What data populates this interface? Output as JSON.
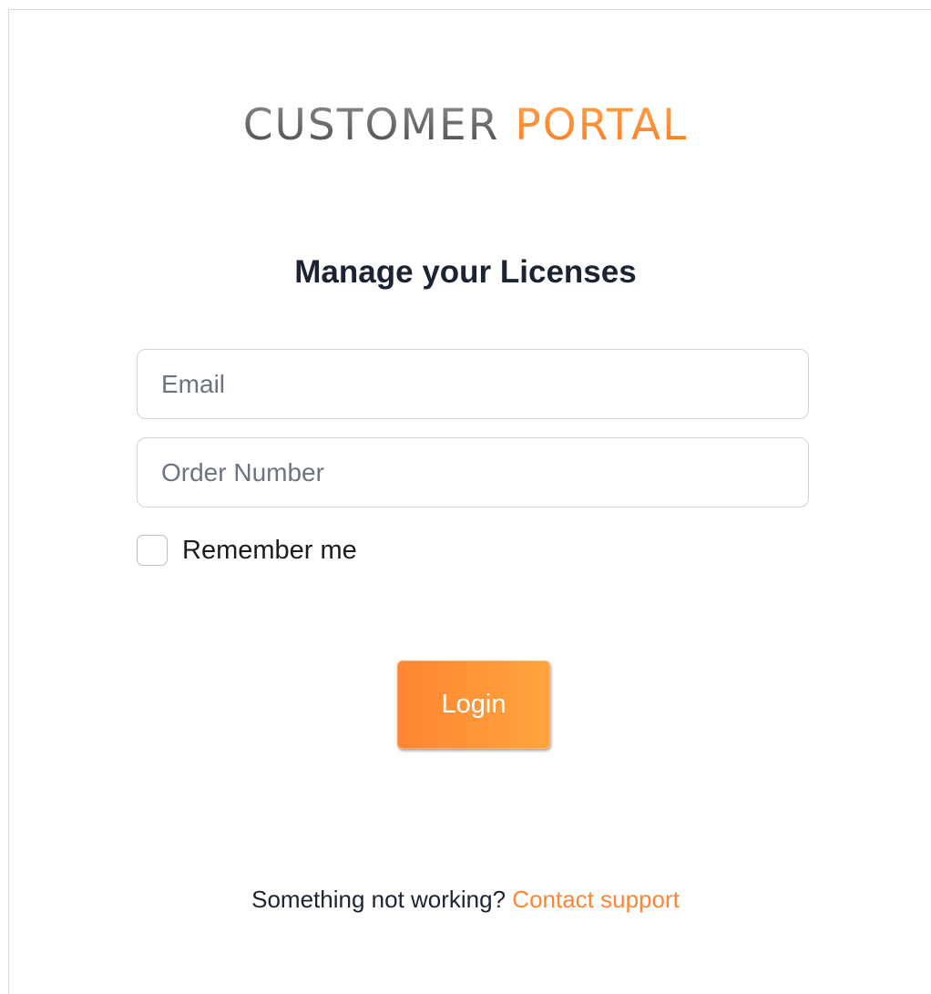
{
  "logo": {
    "word1": "CUSTOMER",
    "word2": "PORTAL",
    "word1_color": "#5a5a5a",
    "word2_color": "#ff8a2a"
  },
  "heading": "Manage your Licenses",
  "form": {
    "email_placeholder": "Email",
    "email_value": "",
    "order_placeholder": "Order Number",
    "order_value": "",
    "remember_label": "Remember me",
    "remember_checked": false,
    "login_label": "Login"
  },
  "footer": {
    "text": "Something not working?",
    "link_label": "Contact support"
  },
  "colors": {
    "accent": "#ff8a2a",
    "heading_text": "#1c2433",
    "input_border": "#cfd4da"
  }
}
